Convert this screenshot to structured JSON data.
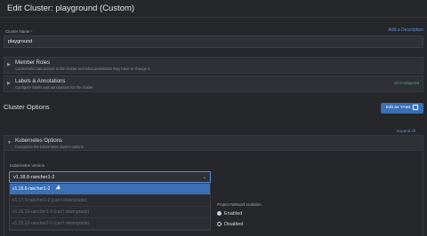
{
  "page": {
    "title": "Edit Cluster: playground (Custom)"
  },
  "cluster_name": {
    "label": "Cluster Name",
    "required_mark": "*",
    "value": "playground",
    "add_description": "Add a Description"
  },
  "panels": {
    "member_roles": {
      "title": "Member Roles",
      "description": "Control who has access to the cluster and what permission they have to change it."
    },
    "labels": {
      "title": "Labels & Annotations",
      "description": "Configure labels and annotations for the cluster.",
      "badge": "10 Configured"
    }
  },
  "cluster_options": {
    "title": "Cluster Options",
    "edit_yaml": "Edit as YAML",
    "expand_all": "Expand All"
  },
  "kubernetes_options": {
    "title": "Kubernetes Options",
    "description": "Customize the kubernetes cluster options"
  },
  "kubernetes_version": {
    "label": "Kubernetes Version",
    "selected": "v1.18.6-rancher1-2",
    "options": [
      "v1.18.6-rancher1-2",
      "v1.17.9-rancher1-2 (can't downgrade)",
      "v1.16.13-rancher1-3 (can't downgrade)",
      "v1.15.12-rancher2-5 (can't downgrade)"
    ]
  },
  "project_network_isolation": {
    "label": "Project Network Isolation",
    "options": [
      "Enabled",
      "Disabled"
    ],
    "selected": "Enabled"
  }
}
